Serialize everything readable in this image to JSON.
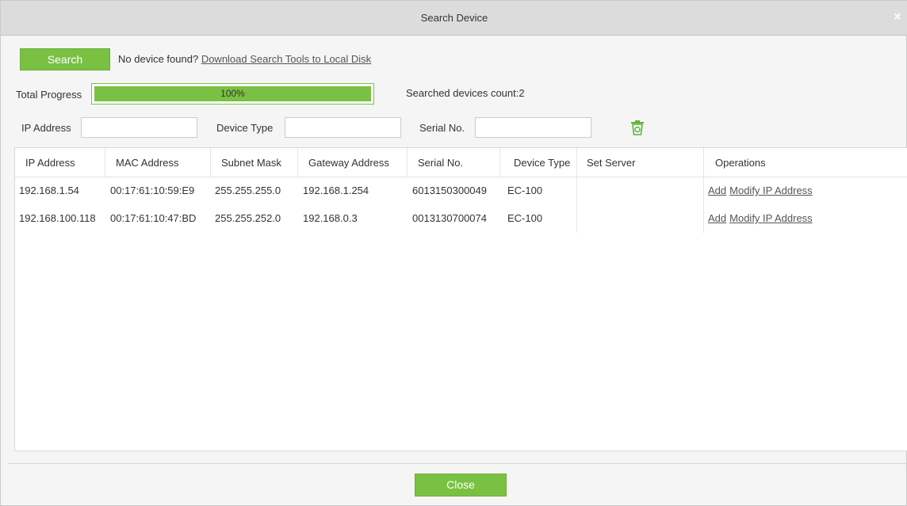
{
  "dialog": {
    "title": "Search Device",
    "close_glyph": "×"
  },
  "toolbar": {
    "search_label": "Search",
    "hint_text": "No device found?",
    "download_link": "Download Search Tools to Local Disk"
  },
  "progress": {
    "label": "Total Progress",
    "percent_text": "100%",
    "fraction": 1.0,
    "count_label": "Searched devices count:2",
    "color": "#7ac143"
  },
  "filters": {
    "ip_label": "IP Address",
    "ip_value": "",
    "type_label": "Device Type",
    "type_value": "",
    "serial_label": "Serial No.",
    "serial_value": "",
    "clear_icon": "trash-icon"
  },
  "table": {
    "columns": [
      "IP Address",
      "MAC Address",
      "Subnet Mask",
      "Gateway Address",
      "Serial No.",
      "Device Type",
      "Set Server",
      "Operations"
    ],
    "rows": [
      {
        "ip": "192.168.1.54",
        "mac": "00:17:61:10:59:E9",
        "mask": "255.255.255.0",
        "gateway": "192.168.1.254",
        "serial": "6013150300049",
        "type": "EC-100",
        "server": "",
        "op_add": "Add",
        "op_modify": "Modify IP Address"
      },
      {
        "ip": "192.168.100.118",
        "mac": "00:17:61:10:47:BD",
        "mask": "255.255.252.0",
        "gateway": "192.168.0.3",
        "serial": "0013130700074",
        "type": "EC-100",
        "server": "",
        "op_add": "Add",
        "op_modify": "Modify IP Address"
      }
    ]
  },
  "footer": {
    "close_label": "Close"
  }
}
